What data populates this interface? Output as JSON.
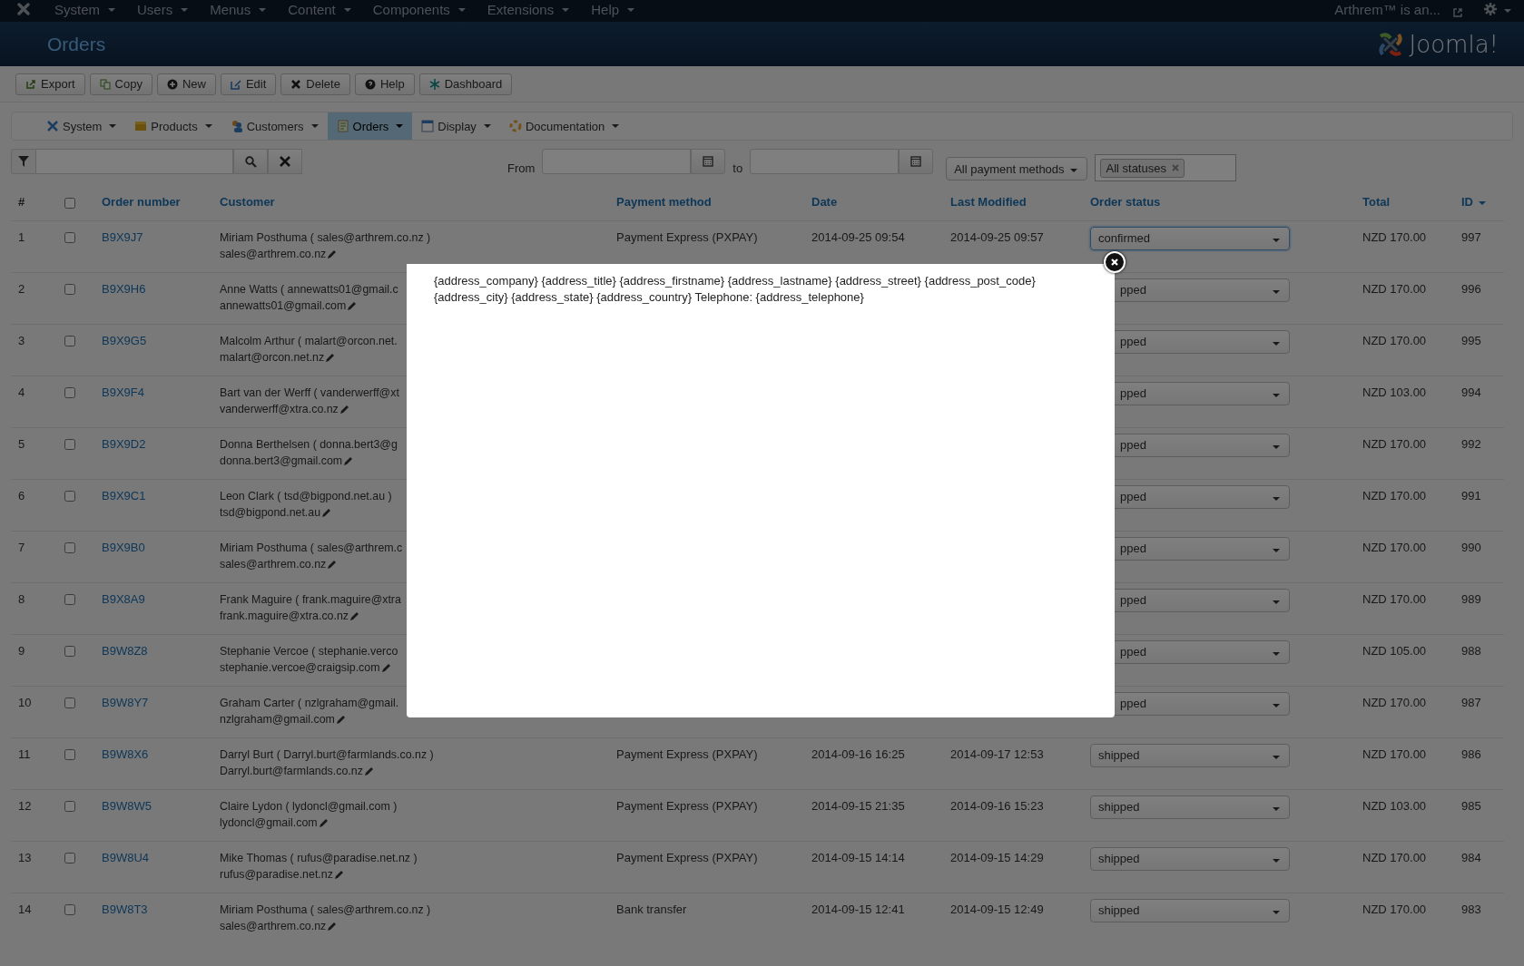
{
  "top_menu": [
    "System",
    "Users",
    "Menus",
    "Content",
    "Components",
    "Extensions",
    "Help"
  ],
  "site_link": "Arthrem™ is an...",
  "page_title": "Orders",
  "logo_text": "Joomla!",
  "toolbar": [
    "Export",
    "Copy",
    "New",
    "Edit",
    "Delete",
    "Help",
    "Dashboard"
  ],
  "submenu": [
    {
      "label": "System",
      "selected": false
    },
    {
      "label": "Products",
      "selected": false
    },
    {
      "label": "Customers",
      "selected": false
    },
    {
      "label": "Orders",
      "selected": true
    },
    {
      "label": "Display",
      "selected": false
    },
    {
      "label": "Documentation",
      "selected": false
    }
  ],
  "filters": {
    "from_label": "From",
    "to_label": "to",
    "payment_method": "All payment methods",
    "status_tag": "All statuses"
  },
  "table": {
    "columns": [
      "#",
      "Order number",
      "Customer",
      "Payment method",
      "Date",
      "Last Modified",
      "Order status",
      "Total",
      "ID"
    ],
    "select_all": {
      "checked": false
    },
    "rows": [
      {
        "n": "1",
        "checked": false,
        "order": "B9X9J7",
        "customer": "Miriam Posthuma ( sales@arthrem.co.nz )",
        "email": "sales@arthrem.co.nz",
        "payment": "Payment Express (PXPAY)",
        "date": "2014-09-25 09:54",
        "modified": "2014-09-25 09:57",
        "status": "confirmed",
        "focused": true,
        "total": "NZD 170.00",
        "id": "997"
      },
      {
        "n": "2",
        "checked": false,
        "order": "B9X9H6",
        "customer": "Anne Watts ( annewatts01@gmail.c",
        "email": "annewatts01@gmail.com",
        "status": "pped",
        "focused": false,
        "total": "NZD 170.00",
        "id": "996"
      },
      {
        "n": "3",
        "checked": false,
        "order": "B9X9G5",
        "customer": "Malcolm Arthur ( malart@orcon.net.",
        "email": "malart@orcon.net.nz",
        "status": "pped",
        "focused": false,
        "total": "NZD 170.00",
        "id": "995"
      },
      {
        "n": "4",
        "checked": false,
        "order": "B9X9F4",
        "customer": "Bart van der Werff ( vanderwerff@xt",
        "email": "vanderwerff@xtra.co.nz",
        "status": "pped",
        "focused": false,
        "total": "NZD 103.00",
        "id": "994"
      },
      {
        "n": "5",
        "checked": false,
        "order": "B9X9D2",
        "customer": "Donna Berthelsen ( donna.bert3@g",
        "email": "donna.bert3@gmail.com",
        "status": "pped",
        "focused": false,
        "total": "NZD 170.00",
        "id": "992"
      },
      {
        "n": "6",
        "checked": false,
        "order": "B9X9C1",
        "customer": "Leon Clark ( tsd@bigpond.net.au )",
        "email": "tsd@bigpond.net.au",
        "status": "pped",
        "focused": false,
        "total": "NZD 170.00",
        "id": "991"
      },
      {
        "n": "7",
        "checked": false,
        "order": "B9X9B0",
        "customer": "Miriam Posthuma ( sales@arthrem.c",
        "email": "sales@arthrem.co.nz",
        "status": "pped",
        "focused": false,
        "total": "NZD 170.00",
        "id": "990"
      },
      {
        "n": "8",
        "checked": false,
        "order": "B9X8A9",
        "customer": "Frank Maguire ( frank.maguire@xtra",
        "email": "frank.maguire@xtra.co.nz",
        "status": "pped",
        "focused": false,
        "total": "NZD 170.00",
        "id": "989"
      },
      {
        "n": "9",
        "checked": false,
        "order": "B9W8Z8",
        "customer": "Stephanie Vercoe ( stephanie.verco",
        "email": "stephanie.vercoe@craigsip.com",
        "status": "pped",
        "focused": false,
        "total": "NZD 105.00",
        "id": "988"
      },
      {
        "n": "10",
        "checked": false,
        "order": "B9W8Y7",
        "customer": "Graham Carter ( nzlgraham@gmail.",
        "email": "nzlgraham@gmail.com",
        "status": "pped",
        "focused": false,
        "total": "NZD 170.00",
        "id": "987"
      },
      {
        "n": "11",
        "checked": false,
        "order": "B9W8X6",
        "customer": "Darryl Burt ( Darryl.burt@farmlands.co.nz )",
        "email": "Darryl.burt@farmlands.co.nz",
        "payment": "Payment Express (PXPAY)",
        "date": "2014-09-16 16:25",
        "modified": "2014-09-17 12:53",
        "status": "shipped",
        "focused": false,
        "total": "NZD 170.00",
        "id": "986"
      },
      {
        "n": "12",
        "checked": false,
        "order": "B9W8W5",
        "customer": "Claire Lydon ( lydoncl@gmail.com )",
        "email": "lydoncl@gmail.com",
        "payment": "Payment Express (PXPAY)",
        "date": "2014-09-15 21:35",
        "modified": "2014-09-16 15:23",
        "status": "shipped",
        "focused": false,
        "total": "NZD 103.00",
        "id": "985"
      },
      {
        "n": "13",
        "checked": false,
        "order": "B9W8U4",
        "customer": "Mike Thomas ( rufus@paradise.net.nz )",
        "email": "rufus@paradise.net.nz",
        "payment": "Payment Express (PXPAY)",
        "date": "2014-09-15 14:14",
        "modified": "2014-09-15 14:29",
        "status": "shipped",
        "focused": false,
        "total": "NZD 170.00",
        "id": "984"
      },
      {
        "n": "14",
        "checked": false,
        "order": "B9W8T3",
        "customer": "Miriam Posthuma ( sales@arthrem.co.nz )",
        "email": "sales@arthrem.co.nz",
        "payment": "Bank transfer",
        "date": "2014-09-15 12:41",
        "modified": "2014-09-15 12:49",
        "status": "shipped",
        "focused": false,
        "total": "NZD 170.00",
        "id": "983"
      }
    ]
  },
  "modal": {
    "text": "{address_company} {address_title} {address_firstname} {address_lastname} {address_street} {address_post_code} {address_city} {address_state} {address_country} Telephone: {address_telephone}"
  }
}
